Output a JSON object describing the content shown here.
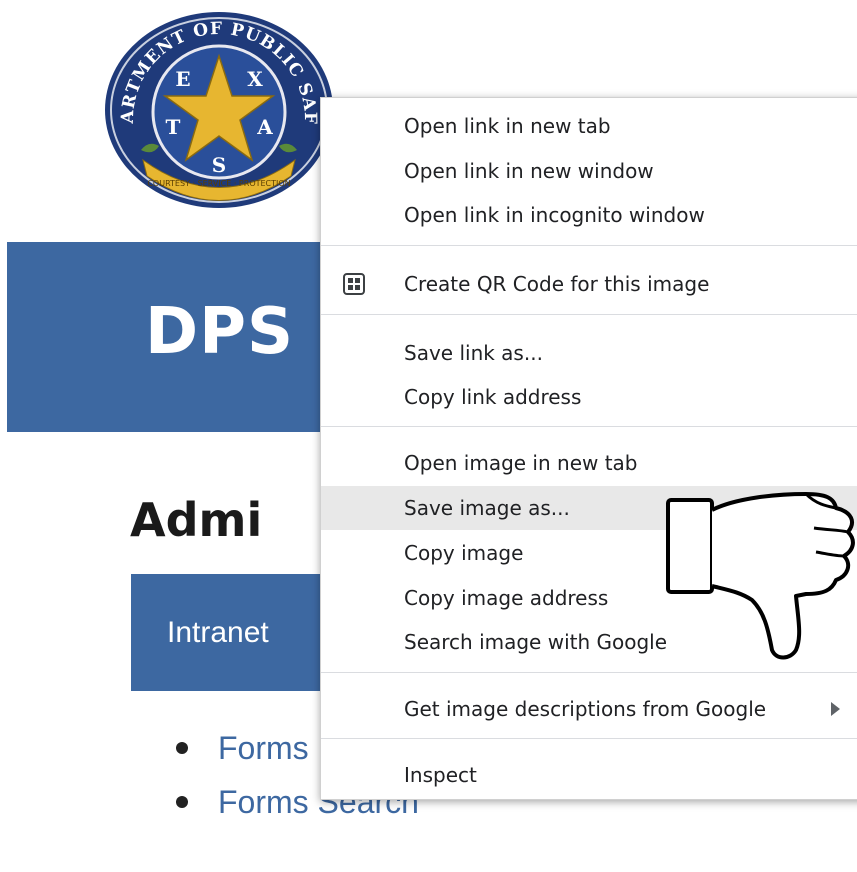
{
  "logo": {
    "top_text": "DEPARTMENT OF PUBLIC SAFETY",
    "letters": [
      "T",
      "E",
      "X",
      "A",
      "S"
    ],
    "ribbon_text": "COURTESY · SERVICE · PROTECTION"
  },
  "banner": {
    "title": "DPS"
  },
  "section": {
    "heading": "Admi",
    "tab_label": "Intranet"
  },
  "links": [
    {
      "label": "Forms"
    },
    {
      "label": "Forms Search"
    }
  ],
  "context_menu": {
    "items": [
      {
        "label": "Open link in new tab"
      },
      {
        "label": "Open link in new window"
      },
      {
        "label": "Open link in incognito window"
      },
      {
        "label": "Create QR Code for this image",
        "icon": "qr-code-icon"
      },
      {
        "label": "Save link as..."
      },
      {
        "label": "Copy link address"
      },
      {
        "label": "Open image in new tab"
      },
      {
        "label": "Save image as...",
        "highlighted": true
      },
      {
        "label": "Copy image"
      },
      {
        "label": "Copy image address"
      },
      {
        "label": "Search image with Google"
      },
      {
        "label": "Get image descriptions from Google",
        "icon": "submenu-arrow-icon"
      },
      {
        "label": "Inspect"
      }
    ]
  },
  "overlay": {
    "icon": "thumbs-down-icon"
  },
  "colors": {
    "brand_blue": "#3d68a1",
    "menu_highlight": "#e8e8e8",
    "logo_navy": "#1f3a7a",
    "logo_gold": "#e7b630"
  }
}
